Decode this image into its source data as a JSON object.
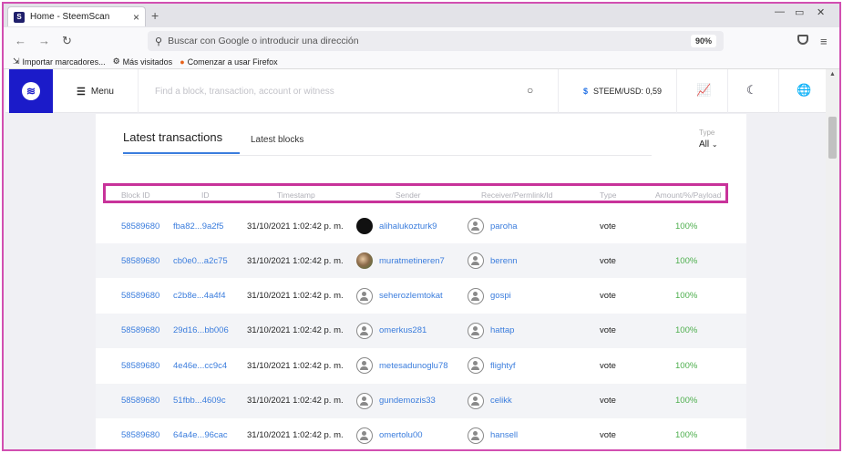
{
  "browser": {
    "tab_title": "Home - SteemScan",
    "tab_close": "×",
    "new_tab": "+",
    "url_placeholder": "Buscar con Google o introducir una dirección",
    "zoom": "90%",
    "bookmarks": [
      {
        "icon": "import-icon",
        "label": "Importar marcadores..."
      },
      {
        "icon": "gear-icon",
        "label": "Más visitados"
      },
      {
        "icon": "firefox-icon",
        "label": "Comenzar a usar Firefox"
      }
    ]
  },
  "site": {
    "menu_label": "Menu",
    "search_placeholder": "Find a block, transaction, account or witness",
    "price_label": "STEEM/USD: 0,59",
    "price_symbol": "$"
  },
  "panel": {
    "tab_active": "Latest transactions",
    "tab_inactive": "Latest blocks",
    "type_label": "Type",
    "type_value": "All"
  },
  "table": {
    "headers": [
      "Block ID",
      "ID",
      "Timestamp",
      "Sender",
      "Receiver/Permlink/Id",
      "Type",
      "Amount/%/Payload"
    ],
    "rows": [
      {
        "block": "58589680",
        "id": "fba82...9a2f5",
        "time": "31/10/2021 1:02:42 p. m.",
        "sender": "alihalukozturk9",
        "sender_avatar": "black",
        "receiver": "paroha",
        "type": "vote",
        "amount": "100%"
      },
      {
        "block": "58589680",
        "id": "cb0e0...a2c75",
        "time": "31/10/2021 1:02:42 p. m.",
        "sender": "muratmetineren7",
        "sender_avatar": "photo",
        "receiver": "berenn",
        "type": "vote",
        "amount": "100%"
      },
      {
        "block": "58589680",
        "id": "c2b8e...4a4f4",
        "time": "31/10/2021 1:02:42 p. m.",
        "sender": "seherozlemtokat",
        "sender_avatar": "default",
        "receiver": "gospi",
        "type": "vote",
        "amount": "100%"
      },
      {
        "block": "58589680",
        "id": "29d16...bb006",
        "time": "31/10/2021 1:02:42 p. m.",
        "sender": "omerkus281",
        "sender_avatar": "default",
        "receiver": "hattap",
        "type": "vote",
        "amount": "100%"
      },
      {
        "block": "58589680",
        "id": "4e46e...cc9c4",
        "time": "31/10/2021 1:02:42 p. m.",
        "sender": "metesadunoglu78",
        "sender_avatar": "default",
        "receiver": "flightyf",
        "type": "vote",
        "amount": "100%"
      },
      {
        "block": "58589680",
        "id": "51fbb...4609c",
        "time": "31/10/2021 1:02:42 p. m.",
        "sender": "gundemozis33",
        "sender_avatar": "default",
        "receiver": "celikk",
        "type": "vote",
        "amount": "100%"
      },
      {
        "block": "58589680",
        "id": "64a4e...96cac",
        "time": "31/10/2021 1:02:42 p. m.",
        "sender": "omertolu00",
        "sender_avatar": "default",
        "receiver": "hansell",
        "type": "vote",
        "amount": "100%"
      }
    ]
  },
  "colors": {
    "accent": "#3b7ddd",
    "brand": "#1b1bc9",
    "highlight": "#c8339a",
    "success": "#4cae4c"
  }
}
